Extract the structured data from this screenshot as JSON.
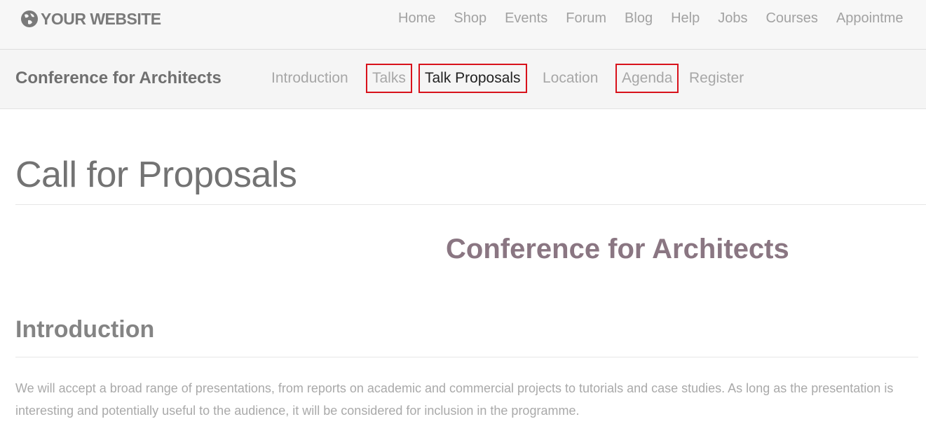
{
  "header": {
    "logo_text": "YOUR WEBSITE",
    "logo_icon": "globe-icon",
    "nav": [
      "Home",
      "Shop",
      "Events",
      "Forum",
      "Blog",
      "Help",
      "Jobs",
      "Courses",
      "Appointme"
    ]
  },
  "subheader": {
    "title": "Conference for Architects",
    "nav": {
      "introduction": "Introduction",
      "talks": "Talks",
      "talk_proposals": "Talk Proposals",
      "location": "Location",
      "agenda": "Agenda",
      "register": "Register"
    }
  },
  "main": {
    "page_title": "Call for Proposals",
    "event_title": "Conference for Architects",
    "section_title": "Introduction",
    "intro_text": "We will accept a broad range of presentations, from reports on academic and commercial projects to tutorials and case studies. As long as the presentation is interesting and potentially useful to the audience, it will be considered for inclusion in the programme."
  },
  "colors": {
    "highlight_border": "#d8121b",
    "event_title": "#8a7682"
  }
}
